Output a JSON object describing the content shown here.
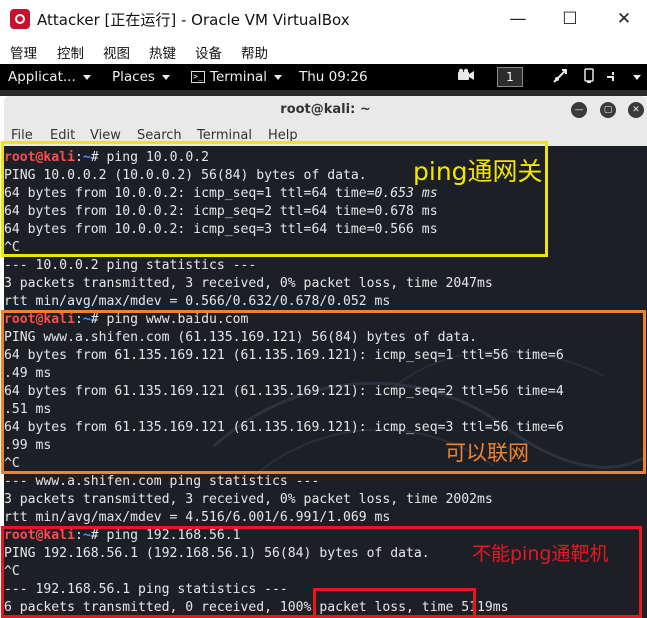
{
  "window": {
    "title": "Attacker [正在运行] - Oracle VM VirtualBox",
    "minimize": "—",
    "maximize": "☐",
    "close": "✕"
  },
  "vbox_menu": [
    "管理",
    "控制",
    "视图",
    "热键",
    "设备",
    "帮助"
  ],
  "gnome_bar": {
    "applications": "Applicat...",
    "places": "Places",
    "terminal": "Terminal",
    "clock": "Thu 09:26",
    "workspace": "1"
  },
  "terminal": {
    "title": "root@kali: ~",
    "menu": [
      "File",
      "Edit",
      "View",
      "Search",
      "Terminal",
      "Help"
    ],
    "prompt": {
      "user": "root@kali",
      "sep": ":",
      "path": "~",
      "symbol": "#"
    },
    "lines": [
      {
        "type": "prompt",
        "cmd": " ping 10.0.0.2"
      },
      {
        "type": "text",
        "text": "PING 10.0.0.2 (10.0.0.2) 56(84) bytes of data."
      },
      {
        "type": "split",
        "text": "64 bytes from 10.0.0.2: icmp_seq=1 ttl=64 time=",
        "em": "0.653 ms"
      },
      {
        "type": "text",
        "text": "64 bytes from 10.0.0.2: icmp_seq=2 ttl=64 time=0.678 ms"
      },
      {
        "type": "text",
        "text": "64 bytes from 10.0.0.2: icmp_seq=3 ttl=64 time=0.566 ms"
      },
      {
        "type": "text",
        "text": "^C"
      },
      {
        "type": "text",
        "text": "--- 10.0.0.2 ping statistics ---"
      },
      {
        "type": "text",
        "text": "3 packets transmitted, 3 received, 0% packet loss, time 2047ms"
      },
      {
        "type": "text",
        "text": "rtt min/avg/max/mdev = 0.566/0.632/0.678/0.052 ms"
      },
      {
        "type": "prompt",
        "cmd": " ping www.baidu.com"
      },
      {
        "type": "text",
        "text": "PING www.a.shifen.com (61.135.169.121) 56(84) bytes of data."
      },
      {
        "type": "text",
        "text": "64 bytes from 61.135.169.121 (61.135.169.121): icmp_seq=1 ttl=56 time=6"
      },
      {
        "type": "text",
        "text": ".49 ms"
      },
      {
        "type": "text",
        "text": "64 bytes from 61.135.169.121 (61.135.169.121): icmp_seq=2 ttl=56 time=4"
      },
      {
        "type": "text",
        "text": ".51 ms"
      },
      {
        "type": "text",
        "text": "64 bytes from 61.135.169.121 (61.135.169.121): icmp_seq=3 ttl=56 time=6"
      },
      {
        "type": "text",
        "text": ".99 ms"
      },
      {
        "type": "text",
        "text": "^C"
      },
      {
        "type": "text",
        "text": "--- www.a.shifen.com ping statistics ---"
      },
      {
        "type": "text",
        "text": "3 packets transmitted, 3 received, 0% packet loss, time 2002ms"
      },
      {
        "type": "text",
        "text": "rtt min/avg/max/mdev = 4.516/6.001/6.991/1.069 ms"
      },
      {
        "type": "prompt",
        "cmd": " ping 192.168.56.1"
      },
      {
        "type": "text",
        "text": "PING 192.168.56.1 (192.168.56.1) 56(84) bytes of data."
      },
      {
        "type": "text",
        "text": "^C"
      },
      {
        "type": "text",
        "text": "--- 192.168.56.1 ping statistics ---"
      },
      {
        "type": "text",
        "text": "6 packets transmitted, 0 received, 100% packet loss, time 5119ms"
      }
    ]
  },
  "annotations": [
    {
      "label": "ping通网关",
      "color": "#f2e500"
    },
    {
      "label": "可以联网",
      "color": "#f0822d"
    },
    {
      "label": "不能ping通靶机",
      "color": "#e8161e"
    },
    {
      "label": "",
      "color": "#e8161e"
    }
  ]
}
